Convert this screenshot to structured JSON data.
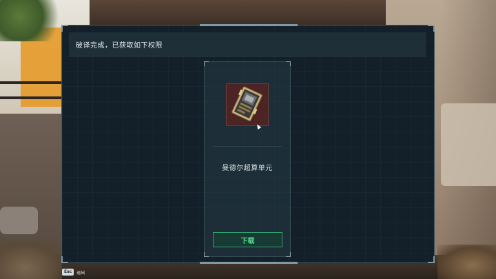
{
  "dialog": {
    "header": "破译完成，已获取如下权限"
  },
  "item": {
    "name": "曼德尔超算单元",
    "icon": "data-chip-icon",
    "frame_color": "#4d2424"
  },
  "actions": {
    "download_label": "下载"
  },
  "footer": {
    "esc_key": "Esc",
    "esc_label": "退出"
  },
  "colors": {
    "panel_bg": "#13202a",
    "accent_green": "#4fd68f",
    "border": "#3c5866"
  }
}
